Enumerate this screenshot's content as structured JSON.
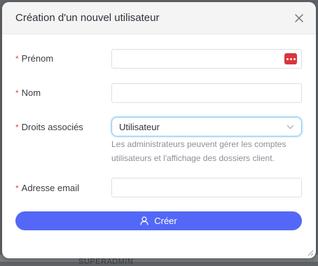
{
  "dialog": {
    "title": "Création d'un nouvel utilisateur",
    "close_icon": "close-icon"
  },
  "form": {
    "required_marker": "*",
    "first_name": {
      "label": "Prénom",
      "value": "",
      "badge_icon": "password-manager-icon"
    },
    "last_name": {
      "label": "Nom",
      "value": ""
    },
    "rights": {
      "label": "Droits associés",
      "selected": "Utilisateur",
      "help": "Les administrateurs peuvent gérer les comptes utilisateurs et l'affichage des dossiers client."
    },
    "email": {
      "label": "Adresse email",
      "value": ""
    },
    "submit": {
      "label": "Créer",
      "icon": "user-icon"
    }
  },
  "background": {
    "peek_text": "SUPERADMIN"
  },
  "colors": {
    "primary": "#5468f7",
    "required": "#e54848",
    "header_bg": "#f4f4f5",
    "select_focus_border": "#87c6ef"
  }
}
